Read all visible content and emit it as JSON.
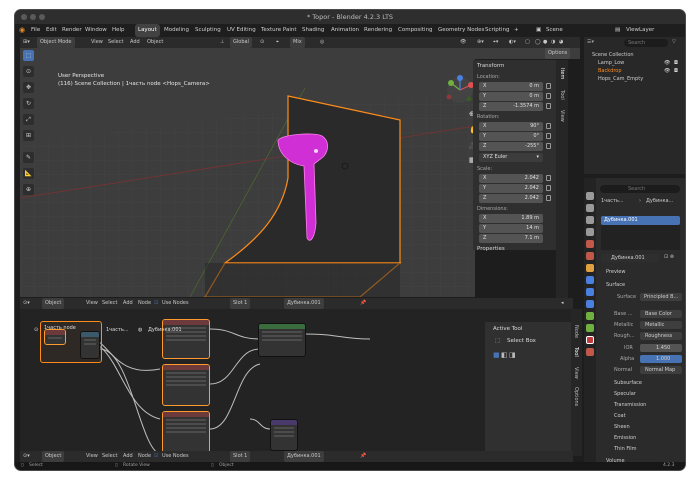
{
  "titlebar": {
    "title": "* Topor - Blender 4.2.3 LTS"
  },
  "menu": {
    "items": [
      "File",
      "Edit",
      "Render",
      "Window",
      "Help"
    ],
    "tabs": [
      "Layout",
      "Modeling",
      "Sculpting",
      "UV Editing",
      "Texture Paint",
      "Shading",
      "Animation",
      "Rendering",
      "Compositing",
      "Geometry Nodes",
      "Scripting"
    ],
    "add_tab": "+",
    "scene": "Scene",
    "view_layer": "ViewLayer"
  },
  "viewport_header": {
    "mode": "Object Mode",
    "menus": [
      "View",
      "Select",
      "Add",
      "Object"
    ],
    "orientation": "Global",
    "pivot": "Mix",
    "options": "Options"
  },
  "viewport": {
    "perspective": "User Perspective",
    "collection_path": "(116) Scene Collection | 1часть node <Hops_Camera>",
    "gizmo_axes": [
      "X",
      "Y",
      "Z"
    ]
  },
  "npanel": {
    "transform_title": "Transform",
    "location_label": "Location:",
    "location": [
      {
        "k": "X",
        "v": "0 m"
      },
      {
        "k": "Y",
        "v": "0 m"
      },
      {
        "k": "Z",
        "v": "-1.3574 m"
      }
    ],
    "rotation_label": "Rotation:",
    "rotation": [
      {
        "k": "X",
        "v": "90°"
      },
      {
        "k": "Y",
        "v": "0°"
      },
      {
        "k": "Z",
        "v": "-255°"
      }
    ],
    "rotation_mode": "XYZ Euler",
    "scale_label": "Scale:",
    "scale": [
      {
        "k": "X",
        "v": "2.042"
      },
      {
        "k": "Y",
        "v": "2.042"
      },
      {
        "k": "Z",
        "v": "2.042"
      }
    ],
    "dimensions_label": "Dimensions:",
    "dimensions": [
      {
        "k": "X",
        "v": "1.89 m"
      },
      {
        "k": "Y",
        "v": "14 m"
      },
      {
        "k": "Z",
        "v": "7.1 m"
      }
    ],
    "properties": "Properties",
    "side_tabs": [
      "Item",
      "Tool",
      "View"
    ]
  },
  "outliner": {
    "root": "Scene Collection",
    "items": [
      "Lamp_Low",
      "Backdrop",
      "Hops_Cam_Empty"
    ]
  },
  "properties": {
    "search_placeholder": "Search",
    "breadcrumb_1": "1часть...",
    "breadcrumb_2": "Дубинка...",
    "material_slot": "Дубинка.001",
    "material_name": "Дубинка.001",
    "preview": "Preview",
    "surface_title": "Surface",
    "surface_label": "Surface",
    "surface_value": "Principled B...",
    "base_label": "Base ...",
    "base_value": "Base Color",
    "metallic_label": "Metallic",
    "metallic_value": "Metallic",
    "rough_label": "Rough...",
    "rough_value": "Roughness",
    "ior_label": "IOR",
    "ior_value": "1.450",
    "alpha_label": "Alpha",
    "alpha_value": "1.000",
    "normal_label": "Normal",
    "normal_value": "Normal Map",
    "sections": [
      "Subsurface",
      "Specular",
      "Transmission",
      "Coat",
      "Sheen",
      "Emission",
      "Thin Film"
    ],
    "volume": "Volume",
    "version": "4.2.3"
  },
  "node_header": {
    "type": "Object",
    "menus": [
      "View",
      "Select",
      "Add",
      "Node"
    ],
    "use_nodes": "Use Nodes",
    "slot": "Slot 1",
    "material": "Дубинка.001",
    "breadcrumb": [
      "1часть node",
      "1часть...",
      "Дубинка.001"
    ]
  },
  "active_tool": {
    "title": "Active Tool",
    "tool": "Select Box",
    "side_tabs": [
      "Node",
      "Tool",
      "View",
      "Options"
    ]
  },
  "bottom_header": {
    "type": "Object",
    "menus": [
      "View",
      "Select",
      "Add",
      "Node"
    ],
    "use_nodes": "Use Nodes",
    "slot": "Slot 1",
    "material": "Дубинка.001"
  },
  "status": {
    "select": "Select",
    "rotate": "Rotate View",
    "object": "Object",
    "version": "4.2.3"
  },
  "colors": {
    "accent": "#4772b3",
    "selection": "#ff8c1a",
    "material": "#d12fd6"
  }
}
